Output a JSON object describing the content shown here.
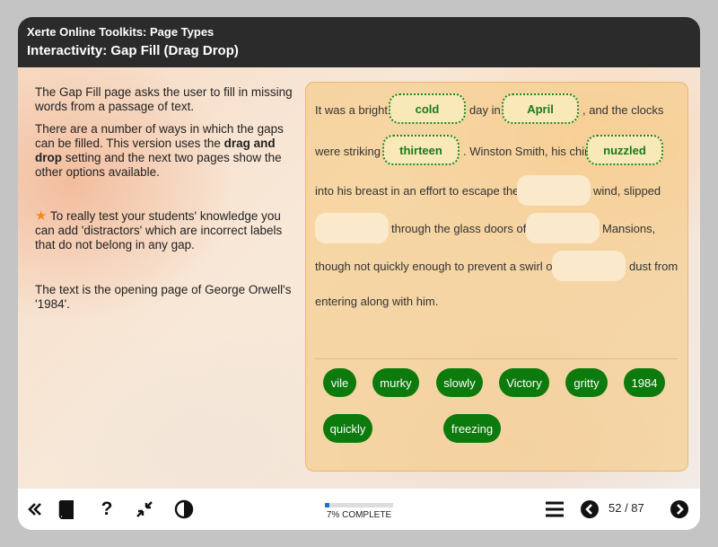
{
  "header": {
    "app_title": "Xerte Online Toolkits: Page Types",
    "page_title": "Interactivity: Gap Fill (Drag Drop)"
  },
  "left": {
    "p1": "The Gap Fill page asks the user to fill in missing words from a passage of text.",
    "p2_a": "There are a number of ways in which the gaps can be filled. This version uses the ",
    "p2_bold": "drag and drop",
    "p2_b": " setting and the next two pages show the other options available.",
    "p3": " To really test your students' knowledge you can add 'distractors' which are incorrect labels that do not belong in any gap.",
    "p4": "The text is the opening page of George Orwell's '1984'."
  },
  "passage": {
    "t1": "It was a bright",
    "t2": "day in",
    "t3": ", and the clocks",
    "t4": "were striking",
    "t5": ". Winston Smith, his chin",
    "t6": "into his breast in an effort to escape the",
    "t7": "wind, slipped",
    "t8": "through the glass doors of",
    "t9": "Mansions,",
    "t10": "though not quickly enough to prevent a swirl of",
    "t11": "dust from",
    "t12": "entering along with him."
  },
  "gaps_filled": [
    "cold",
    "April",
    "thirteen",
    "nuzzled"
  ],
  "labels": [
    "vile",
    "murky",
    "slowly",
    "Victory",
    "gritty",
    "1984",
    "quickly",
    "freezing"
  ],
  "footer": {
    "progress_percent": 7,
    "progress_label": "7% COMPLETE",
    "page_count": "52 / 87"
  },
  "colors": {
    "header_bg": "#2b2b2b",
    "chip_bg": "#0d7a0d",
    "gap_border": "#1a8a1a",
    "progress_fill": "#1f6fd0"
  },
  "icons": [
    "rewind-icon",
    "glossary-book-icon",
    "help-icon",
    "collapse-icon",
    "contrast-icon",
    "menu-icon",
    "previous-icon",
    "next-icon",
    "star-icon"
  ]
}
